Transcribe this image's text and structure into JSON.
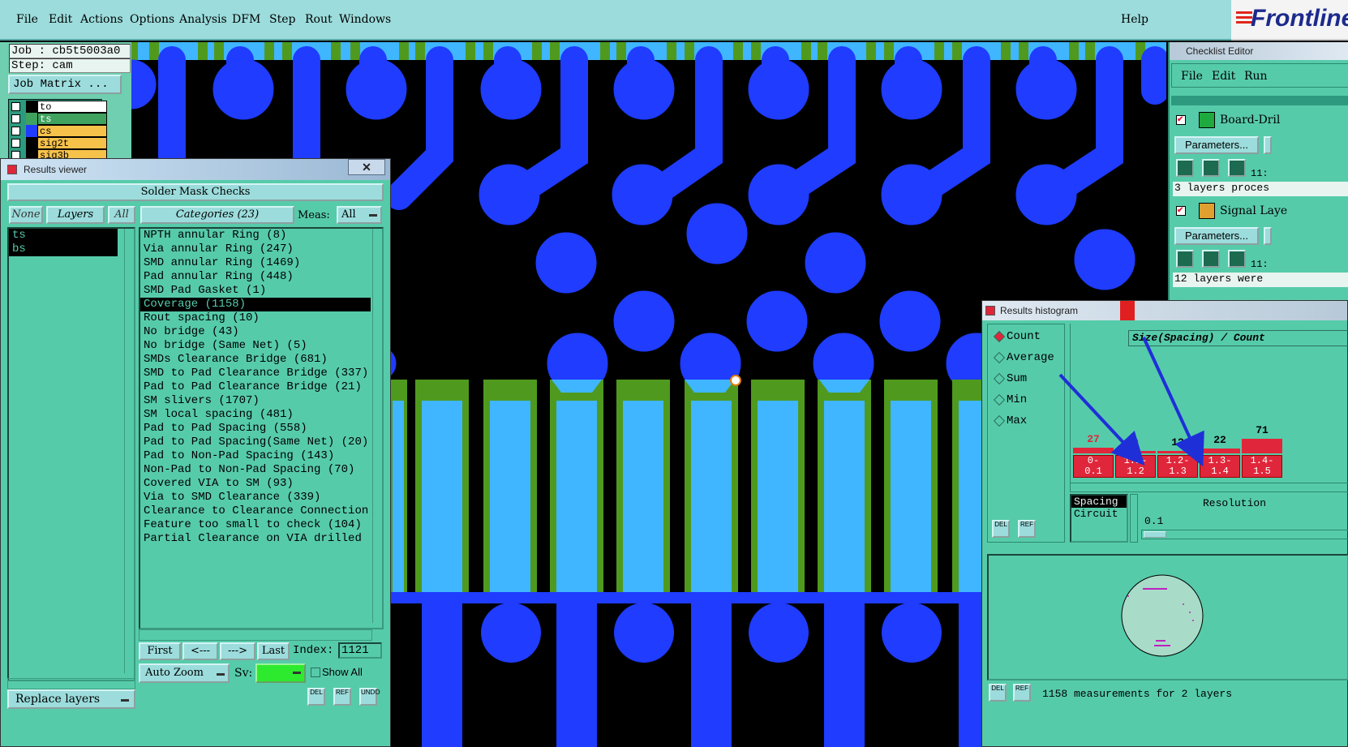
{
  "menu": {
    "items": [
      "File",
      "Edit",
      "Actions",
      "Options",
      "Analysis",
      "DFM",
      "Step",
      "Rout",
      "Windows"
    ],
    "help": "Help",
    "brand": "Frontline"
  },
  "job_panel": {
    "job": "Job : cb5t5003a0",
    "step": "Step: cam",
    "job_matrix": "Job Matrix ...",
    "layers": [
      {
        "name": "to",
        "color": "#ffffff",
        "swatch": "#000000"
      },
      {
        "name": "ts",
        "color": "#3fa35f",
        "swatch": "#3fa35f"
      },
      {
        "name": "cs",
        "color": "#f6c24a",
        "swatch": "#1f3cff"
      },
      {
        "name": "sig2t",
        "color": "#f6c24a",
        "swatch": "#000000"
      },
      {
        "name": "sig3b",
        "color": "#f6c24a",
        "swatch": "#000000"
      }
    ]
  },
  "results_viewer": {
    "title": "Results viewer",
    "header": "Solder Mask Checks",
    "none_btn": "None",
    "layers_btn": "Layers",
    "all_btn": "All",
    "categories_btn": "Categories (23)",
    "meas_label": "Meas:",
    "meas_value": "All",
    "layers": [
      "ts",
      "bs"
    ],
    "categories": [
      "NPTH annular Ring (8)",
      "Via annular Ring (247)",
      "SMD annular Ring (1469)",
      "Pad annular Ring (448)",
      "SMD Pad Gasket (1)",
      "Coverage (1158)",
      "Rout spacing (10)",
      "No bridge (43)",
      "No bridge (Same Net) (5)",
      "SMDs Clearance Bridge (681)",
      "SMD to Pad Clearance Bridge (337)",
      "Pad to Pad Clearance Bridge (21)",
      "SM slivers (1707)",
      "SM local spacing (481)",
      "Pad to Pad Spacing (558)",
      "Pad to Pad Spacing(Same Net) (20)",
      "Pad to Non-Pad Spacing (143)",
      "Non-Pad to Non-Pad Spacing (70)",
      "Covered VIA to SM (93)",
      "Via to SMD Clearance (339)",
      "Clearance to Clearance Connection",
      "Feature too small to check (104)",
      "Partial Clearance on VIA drilled"
    ],
    "selected_index": 5,
    "nav": {
      "first": "First",
      "prev": "<---",
      "next": "--->",
      "last": "Last",
      "index_label": "Index:",
      "index_value": "1121"
    },
    "auto_zoom": "Auto Zoom",
    "sv_label": "Sv:",
    "show_all": "Show All",
    "replace_layers": "Replace layers",
    "del": "DEL",
    "ref": "REF",
    "undo": "UNDO"
  },
  "checklist_editor": {
    "title": "Checklist Editor",
    "menu": [
      "File",
      "Edit",
      "Run"
    ],
    "items": [
      {
        "name": "Board-Dril",
        "params": "Parameters...",
        "time": "11:",
        "status": "3 layers proces"
      },
      {
        "name": "Signal Laye",
        "params": "Parameters...",
        "time": "11:",
        "status": "12 layers were"
      }
    ]
  },
  "histogram": {
    "title": "Results histogram",
    "modes": [
      "Count",
      "Average",
      "Sum",
      "Min",
      "Max"
    ],
    "selected_mode": "Count",
    "header": "Size(Spacing) / Count",
    "bars": [
      {
        "value": "27",
        "bin": [
          "0-",
          "0.1"
        ]
      },
      {
        "value": "9",
        "bin": [
          "1.1-",
          "1.2"
        ]
      },
      {
        "value": "12",
        "bin": [
          "1.2-",
          "1.3"
        ]
      },
      {
        "value": "22",
        "bin": [
          "1.3-",
          "1.4"
        ]
      },
      {
        "value": "71",
        "bin": [
          "1.4-",
          "1.5"
        ]
      }
    ],
    "attr_list": [
      "Spacing",
      "Circuit"
    ],
    "resolution_label": "Resolution",
    "resolution_value": "0.1",
    "footer": "1158 measurements for 2 layers",
    "del": "DEL",
    "ref": "REF"
  },
  "colors": {
    "panel": "#56cbaa",
    "menubar": "#9cdcdc",
    "trace": "#1f3cff",
    "mask": "#3fb6ff",
    "green": "#4f9a1e",
    "bar_red": "#e0263a"
  }
}
